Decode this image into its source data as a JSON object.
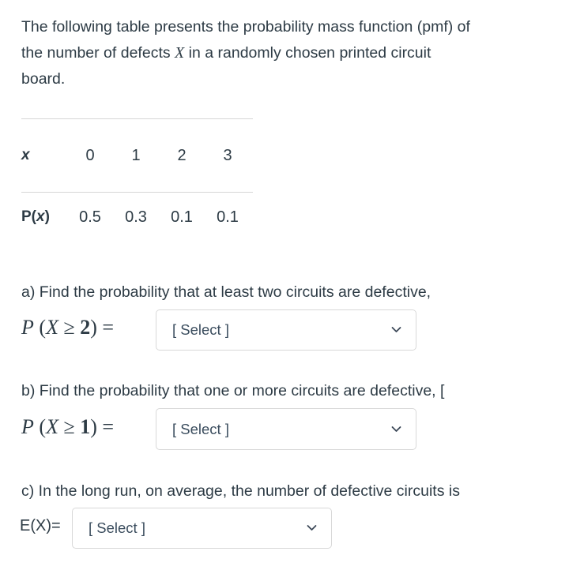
{
  "intro": {
    "line1": "The following table presents the probability mass function (pmf) of",
    "line2_before": "the number of defects ",
    "line2_var": "X",
    "line2_after": " in a randomly chosen printed circuit",
    "line3": "board."
  },
  "table": {
    "row_x_label": "x",
    "row_p_label_p": "P(",
    "row_p_label_x": "x",
    "row_p_label_close": ")",
    "x_values": [
      "0",
      "1",
      "2",
      "3"
    ],
    "p_values": [
      "0.5",
      "0.3",
      "0.1",
      "0.1"
    ]
  },
  "questions": {
    "a": {
      "prompt": "a) Find the probability that at least two circuits are defective,",
      "math_p": "P",
      "math_open": " (",
      "math_var": "X",
      "math_rel": " ≥ ",
      "math_num": "2",
      "math_close": ") =",
      "select_value": "[ Select ]"
    },
    "b": {
      "prompt": "b) Find the probability that one or more circuits are defective, [",
      "math_p": "P",
      "math_open": " (",
      "math_var": "X",
      "math_rel": " ≥ ",
      "math_num": "1",
      "math_close": ") =",
      "select_value": "[ Select ]"
    },
    "c": {
      "prompt": "c) In the long run, on average, the number of defective circuits is",
      "label": "E(X)=",
      "select_value": "[ Select ]"
    }
  },
  "icons": {
    "dropdown_chevron": "chevron-down-icon"
  },
  "colors": {
    "text": "#2d3b45",
    "rule": "#d6d6d6",
    "select_border": "#d8d8d8",
    "background": "#ffffff"
  }
}
